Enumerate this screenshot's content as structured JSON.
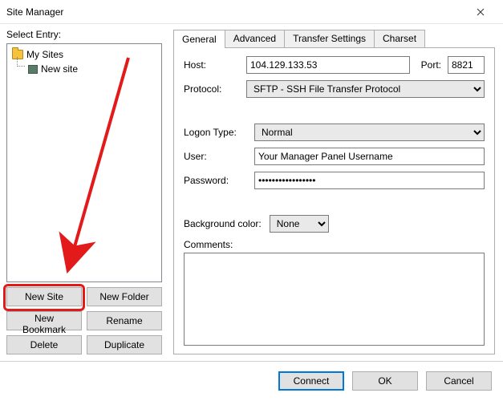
{
  "window": {
    "title": "Site Manager"
  },
  "left": {
    "select_entry": "Select Entry:",
    "root_folder": "My Sites",
    "new_site_item": "New site",
    "buttons": {
      "new_site": "New Site",
      "new_folder": "New Folder",
      "new_bookmark": "New Bookmark",
      "rename": "Rename",
      "delete": "Delete",
      "duplicate": "Duplicate"
    }
  },
  "tabs": {
    "general": "General",
    "advanced": "Advanced",
    "transfer": "Transfer Settings",
    "charset": "Charset"
  },
  "general": {
    "host_label": "Host:",
    "host_value": "104.129.133.53",
    "port_label": "Port:",
    "port_value": "8821",
    "protocol_label": "Protocol:",
    "protocol_value": "SFTP - SSH File Transfer Protocol",
    "logon_label": "Logon Type:",
    "logon_value": "Normal",
    "user_label": "User:",
    "user_value": "Your Manager Panel Username",
    "password_label": "Password:",
    "password_value": "•••••••••••••••••",
    "bgcolor_label": "Background color:",
    "bgcolor_value": "None",
    "comments_label": "Comments:",
    "comments_value": ""
  },
  "footer": {
    "connect": "Connect",
    "ok": "OK",
    "cancel": "Cancel"
  }
}
